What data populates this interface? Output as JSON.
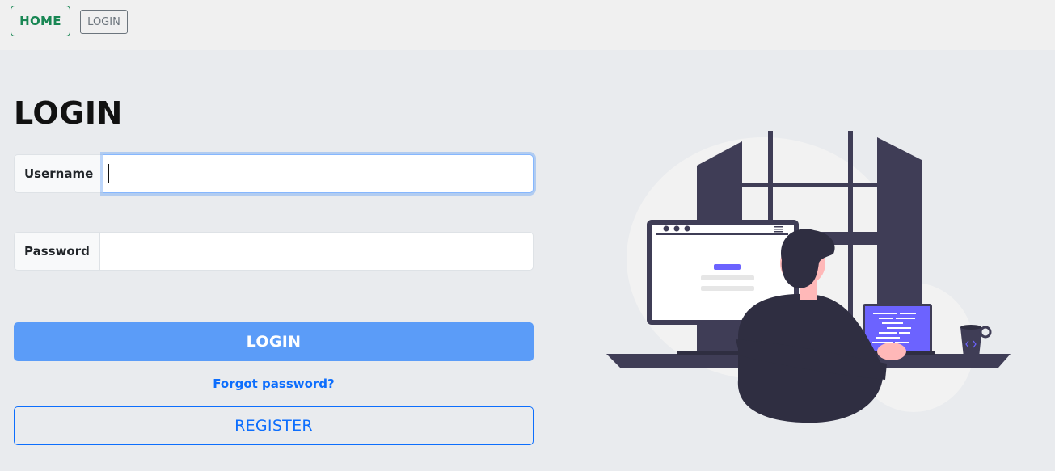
{
  "nav": {
    "home_label": "HOME",
    "login_label": "LOGIN"
  },
  "page": {
    "title": "LOGIN"
  },
  "form": {
    "username_label": "Username",
    "username_value": "",
    "password_label": "Password",
    "password_value": "",
    "login_button": "LOGIN",
    "forgot_link": "Forgot password?",
    "register_button": "REGISTER"
  },
  "illustration": {
    "name": "working-at-computer-illustration"
  },
  "colors": {
    "background": "#e9ebee",
    "topbar": "#f0f0f0",
    "success": "#198754",
    "primary": "#0d6efd",
    "login_button": "#5b9cf8",
    "illustration_dark": "#3f3d56",
    "illustration_accent": "#6c63ff"
  }
}
